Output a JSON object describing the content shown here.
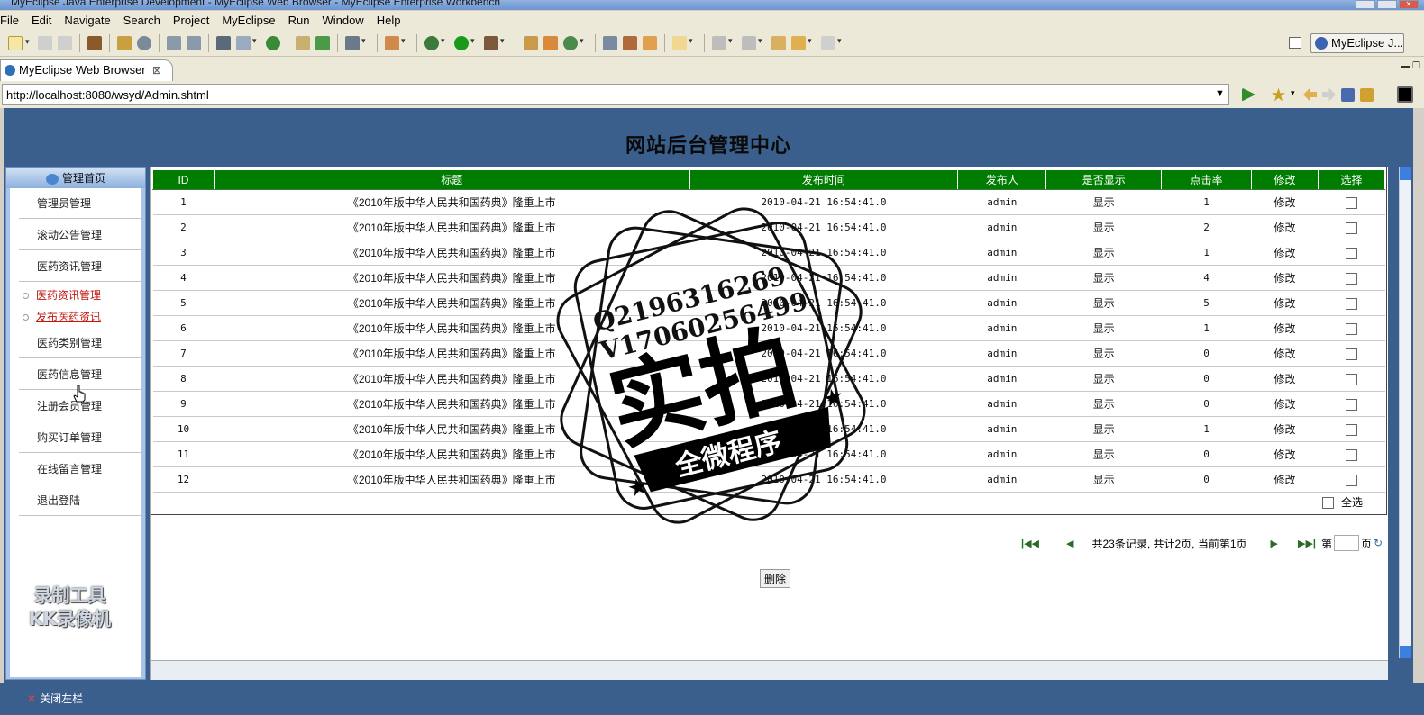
{
  "window": {
    "title": "MyEclipse Java Enterprise Development - MyEclipse Web Browser - MyEclipse Enterprise Workbench"
  },
  "menu": [
    "File",
    "Edit",
    "Navigate",
    "Search",
    "Project",
    "MyEclipse",
    "Run",
    "Window",
    "Help"
  ],
  "perspective": {
    "label": "MyEclipse J..."
  },
  "editor_tab": {
    "label": "MyEclipse Web Browser",
    "close": "⊠"
  },
  "url": {
    "value": "http://localhost:8080/wsyd/Admin.shtml"
  },
  "page": {
    "title": "网站后台管理中心",
    "sidebar": {
      "header": "管理首页",
      "items": [
        {
          "label": "管理员管理"
        },
        {
          "label": "滚动公告管理"
        },
        {
          "label": "医药资讯管理"
        },
        {
          "label": "医药类别管理"
        },
        {
          "label": "医药信息管理"
        },
        {
          "label": "注册会员管理"
        },
        {
          "label": "购买订单管理"
        },
        {
          "label": "在线留言管理"
        },
        {
          "label": "退出登陆"
        }
      ],
      "sub_items": [
        {
          "label": "医药资讯管理"
        },
        {
          "label": "发布医药资讯"
        }
      ]
    },
    "table": {
      "headers": [
        "ID",
        "标题",
        "发布时间",
        "发布人",
        "是否显示",
        "点击率",
        "修改",
        "选择"
      ],
      "rows": [
        {
          "id": "1",
          "title": "《2010年版中华人民共和国药典》隆重上市",
          "time": "2010-04-21 16:54:41.0",
          "author": "admin",
          "show": "显示",
          "clicks": "1",
          "edit": "修改"
        },
        {
          "id": "2",
          "title": "《2010年版中华人民共和国药典》隆重上市",
          "time": "2010-04-21 16:54:41.0",
          "author": "admin",
          "show": "显示",
          "clicks": "2",
          "edit": "修改"
        },
        {
          "id": "3",
          "title": "《2010年版中华人民共和国药典》隆重上市",
          "time": "2010-04-21 16:54:41.0",
          "author": "admin",
          "show": "显示",
          "clicks": "1",
          "edit": "修改"
        },
        {
          "id": "4",
          "title": "《2010年版中华人民共和国药典》隆重上市",
          "time": "2010-04-21 16:54:41.0",
          "author": "admin",
          "show": "显示",
          "clicks": "4",
          "edit": "修改"
        },
        {
          "id": "5",
          "title": "《2010年版中华人民共和国药典》隆重上市",
          "time": "2010-04-21 16:54:41.0",
          "author": "admin",
          "show": "显示",
          "clicks": "5",
          "edit": "修改"
        },
        {
          "id": "6",
          "title": "《2010年版中华人民共和国药典》隆重上市",
          "time": "2010-04-21 16:54:41.0",
          "author": "admin",
          "show": "显示",
          "clicks": "1",
          "edit": "修改"
        },
        {
          "id": "7",
          "title": "《2010年版中华人民共和国药典》隆重上市",
          "time": "2010-04-21 16:54:41.0",
          "author": "admin",
          "show": "显示",
          "clicks": "0",
          "edit": "修改"
        },
        {
          "id": "8",
          "title": "《2010年版中华人民共和国药典》隆重上市",
          "time": "2010-04-21 16:54:41.0",
          "author": "admin",
          "show": "显示",
          "clicks": "0",
          "edit": "修改"
        },
        {
          "id": "9",
          "title": "《2010年版中华人民共和国药典》隆重上市",
          "time": "2010-04-21 16:54:41.0",
          "author": "admin",
          "show": "显示",
          "clicks": "0",
          "edit": "修改"
        },
        {
          "id": "10",
          "title": "《2010年版中华人民共和国药典》隆重上市",
          "time": "2010-04-21 16:54:41.0",
          "author": "admin",
          "show": "显示",
          "clicks": "1",
          "edit": "修改"
        },
        {
          "id": "11",
          "title": "《2010年版中华人民共和国药典》隆重上市",
          "time": "2010-04-21 16:54:41.0",
          "author": "admin",
          "show": "显示",
          "clicks": "0",
          "edit": "修改"
        },
        {
          "id": "12",
          "title": "《2010年版中华人民共和国药典》隆重上市",
          "time": "2010-04-21 16:54:41.0",
          "author": "admin",
          "show": "显示",
          "clicks": "0",
          "edit": "修改"
        }
      ],
      "select_all": "全选"
    },
    "pager": {
      "summary": "共23条记录, 共计2页, 当前第1页",
      "goto_prefix": "第",
      "goto_suffix": "页"
    },
    "delete_button": "删除",
    "close_sidebar": "关闭左栏"
  },
  "watermarks": {
    "recorder": [
      "录制工具",
      "KK录像机"
    ],
    "stamp": {
      "line1": "Q2196316269",
      "line2": "V17060256499",
      "main": "实拍",
      "banner": "全微程序"
    }
  },
  "colors": {
    "header_green": "#007c00",
    "page_blue": "#3a5f8d",
    "link_red": "#c0160e"
  }
}
